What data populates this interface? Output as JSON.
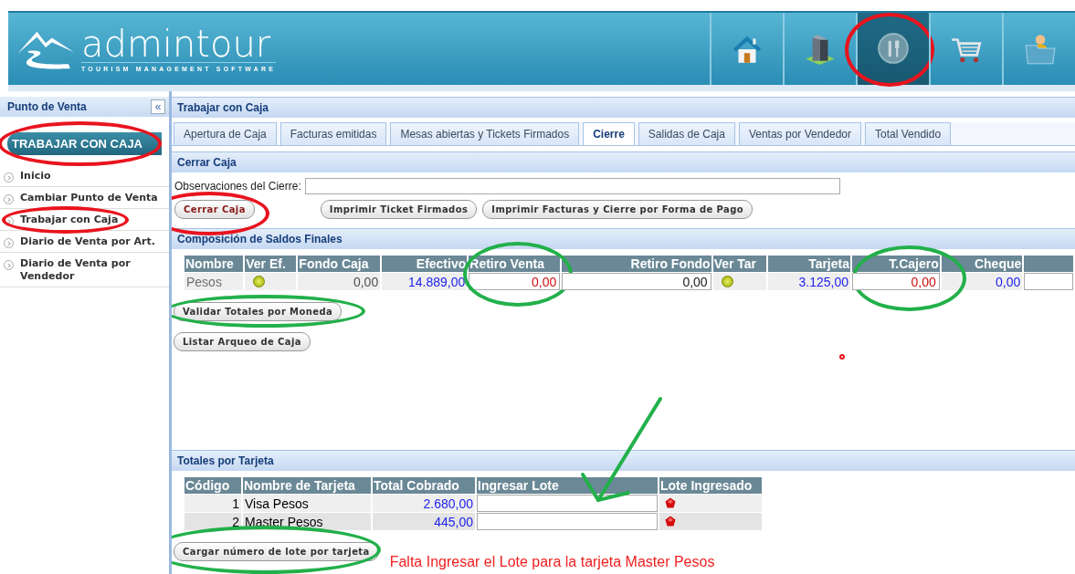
{
  "header": {
    "logo_text": "admintour",
    "tagline": "TOURISM MANAGEMENT SOFTWARE"
  },
  "nav": [
    {
      "kind": "home",
      "selected": false
    },
    {
      "kind": "building",
      "selected": false
    },
    {
      "kind": "dining",
      "selected": true,
      "highlight": {
        "color": "#e8141e"
      }
    },
    {
      "kind": "cart",
      "selected": false
    },
    {
      "kind": "person",
      "selected": false
    }
  ],
  "sidebar": {
    "title": "Punto de Venta",
    "collapse": "«",
    "heading": {
      "text": "TRABAJAR CON CAJA",
      "highlight": {
        "color": "#e8141e"
      }
    },
    "items": [
      {
        "label": "Inicio"
      },
      {
        "label": "Cambiar Punto de Venta"
      },
      {
        "label": "Trabajar con Caja",
        "highlight": {
          "color": "#e8141e"
        }
      },
      {
        "label": "Diario de Venta por Art."
      },
      {
        "label": "Diario de Venta por Vendedor"
      }
    ]
  },
  "panel": {
    "title": "Trabajar con Caja",
    "tabs": [
      {
        "label": "Apertura de Caja",
        "selected": false
      },
      {
        "label": "Facturas emitidas",
        "selected": false
      },
      {
        "label": "Mesas abiertas y Tickets Firmados",
        "selected": false
      },
      {
        "label": "Cierre",
        "selected": true
      },
      {
        "label": "Salidas de Caja",
        "selected": false
      },
      {
        "label": "Ventas por Vendedor",
        "selected": false
      },
      {
        "label": "Total Vendido",
        "selected": false
      }
    ],
    "cerrar_caja": {
      "title": "Cerrar Caja",
      "observaciones_label": "Observaciones del Cierre:",
      "buttons": [
        {
          "label": "Cerrar Caja",
          "kind": "danger",
          "highlight": {
            "color": "#e8141e"
          }
        },
        {
          "label": "Imprimir Ticket Firmados",
          "kind": "normal"
        },
        {
          "label": "Imprimir Facturas y Cierre por Forma de Pago",
          "kind": "normal"
        }
      ]
    },
    "saldos": {
      "title": "Composición de Saldos Finales",
      "columns": [
        {
          "label": "Nombre"
        },
        {
          "label": "Ver Ef."
        },
        {
          "label": "Fondo Caja"
        },
        {
          "label": "Efectivo"
        },
        {
          "label": "Retiro Venta"
        },
        {
          "label": "Retiro Fondo"
        },
        {
          "label": "Ver Tar"
        },
        {
          "label": "Tarjeta"
        },
        {
          "label": "T.Cajero",
          "highlight": {
            "color": "#22b04a"
          }
        },
        {
          "label": "Cheque"
        }
      ],
      "rows": [
        [
          {
            "kind": "text",
            "text": "Pesos",
            "color": "#707070"
          },
          {
            "kind": "icon"
          },
          {
            "kind": "number",
            "text": "0,00",
            "color": "#505050"
          },
          {
            "kind": "number",
            "text": "14.889,00",
            "color": "#2222ee"
          },
          {
            "kind": "input",
            "value": "0,00",
            "color": "#d01010",
            "highlight": {
              "color": "#22b04a"
            }
          },
          {
            "kind": "input",
            "value": "0,00",
            "color": "#202020"
          },
          {
            "kind": "icon"
          },
          {
            "kind": "number",
            "text": "3.125,00",
            "color": "#2222ee"
          },
          {
            "kind": "input",
            "value": "0,00",
            "color": "#d01010"
          },
          {
            "kind": "number",
            "text": "0,00",
            "color": "#2222ee"
          },
          {
            "kind": "input"
          }
        ]
      ],
      "buttons": [
        {
          "label": "Validar Totales por Moneda",
          "kind": "normal",
          "highlight": {
            "color": "#22b04a"
          }
        },
        {
          "label": "Listar Arqueo de Caja",
          "kind": "normal"
        }
      ]
    },
    "tarjetas": {
      "title": "Totales por Tarjeta",
      "columns": [
        "Código",
        "Nombre de Tarjeta",
        "Total Cobrado",
        "Ingresar Lote",
        "Lote Ingresado"
      ],
      "rows": [
        {
          "codigo": "1",
          "nombre": "Visa Pesos",
          "total": "2.680,00",
          "lote_ingresado": false
        },
        {
          "codigo": "2",
          "nombre": "Master Pesos",
          "total": "445,00",
          "lote_ingresado": false
        }
      ],
      "button": {
        "label": "Cargar número de lote por tarjeta",
        "kind": "normal",
        "highlight": {
          "color": "#22b04a"
        }
      },
      "message": "Falta Ingresar el Lote para la tarjeta Master Pesos"
    }
  },
  "annotations": [
    {
      "kind": "arrow",
      "color": "#22b04a"
    },
    {
      "kind": "dot",
      "color": "#e8141e"
    }
  ]
}
